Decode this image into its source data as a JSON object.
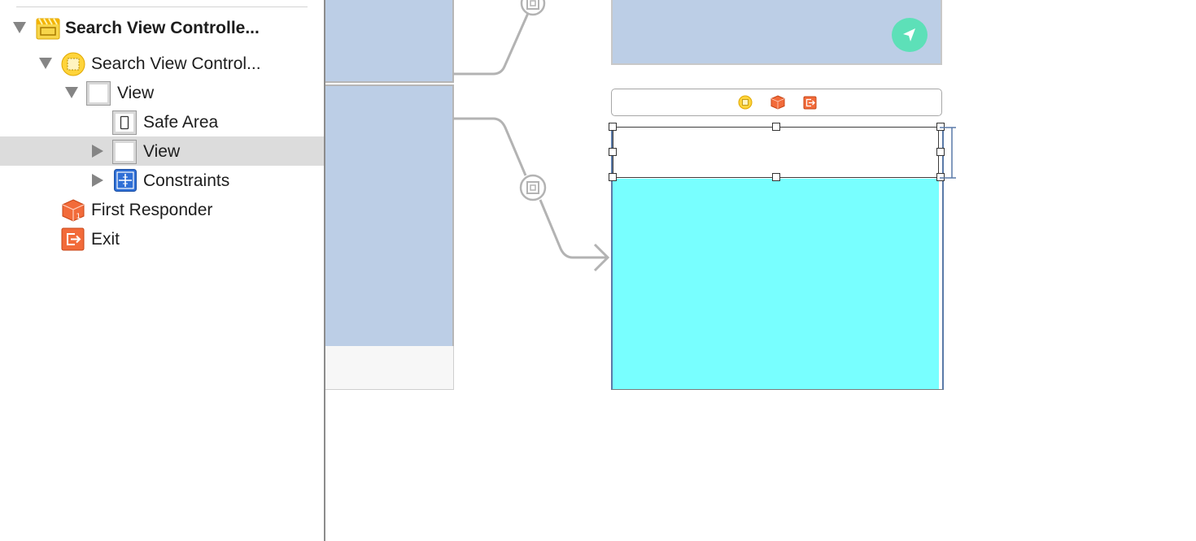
{
  "outline": {
    "items": [
      {
        "label": "Search View Controlle...",
        "icon": "scene-icon",
        "expanded": true
      },
      {
        "label": "Search View Control...",
        "icon": "view-controller-icon",
        "expanded": true
      },
      {
        "label": "View",
        "icon": "view-icon",
        "expanded": true
      },
      {
        "label": "Safe Area",
        "icon": "safe-area-icon"
      },
      {
        "label": "View",
        "icon": "view-icon",
        "expanded": false,
        "selected": true
      },
      {
        "label": "Constraints",
        "icon": "constraints-icon",
        "expanded": false
      },
      {
        "label": "First Responder",
        "icon": "first-responder-icon"
      },
      {
        "label": "Exit",
        "icon": "exit-icon"
      }
    ]
  },
  "canvas": {
    "scene_dock_icons": [
      "view-controller-icon",
      "first-responder-icon",
      "exit-icon"
    ],
    "colors": {
      "scene_blue": "#bccee6",
      "cyan_view": "#78ffff",
      "locate_button": "#5de0b8",
      "selection_row": "#dcdcdc",
      "segue_line": "#b3b3b3"
    }
  }
}
